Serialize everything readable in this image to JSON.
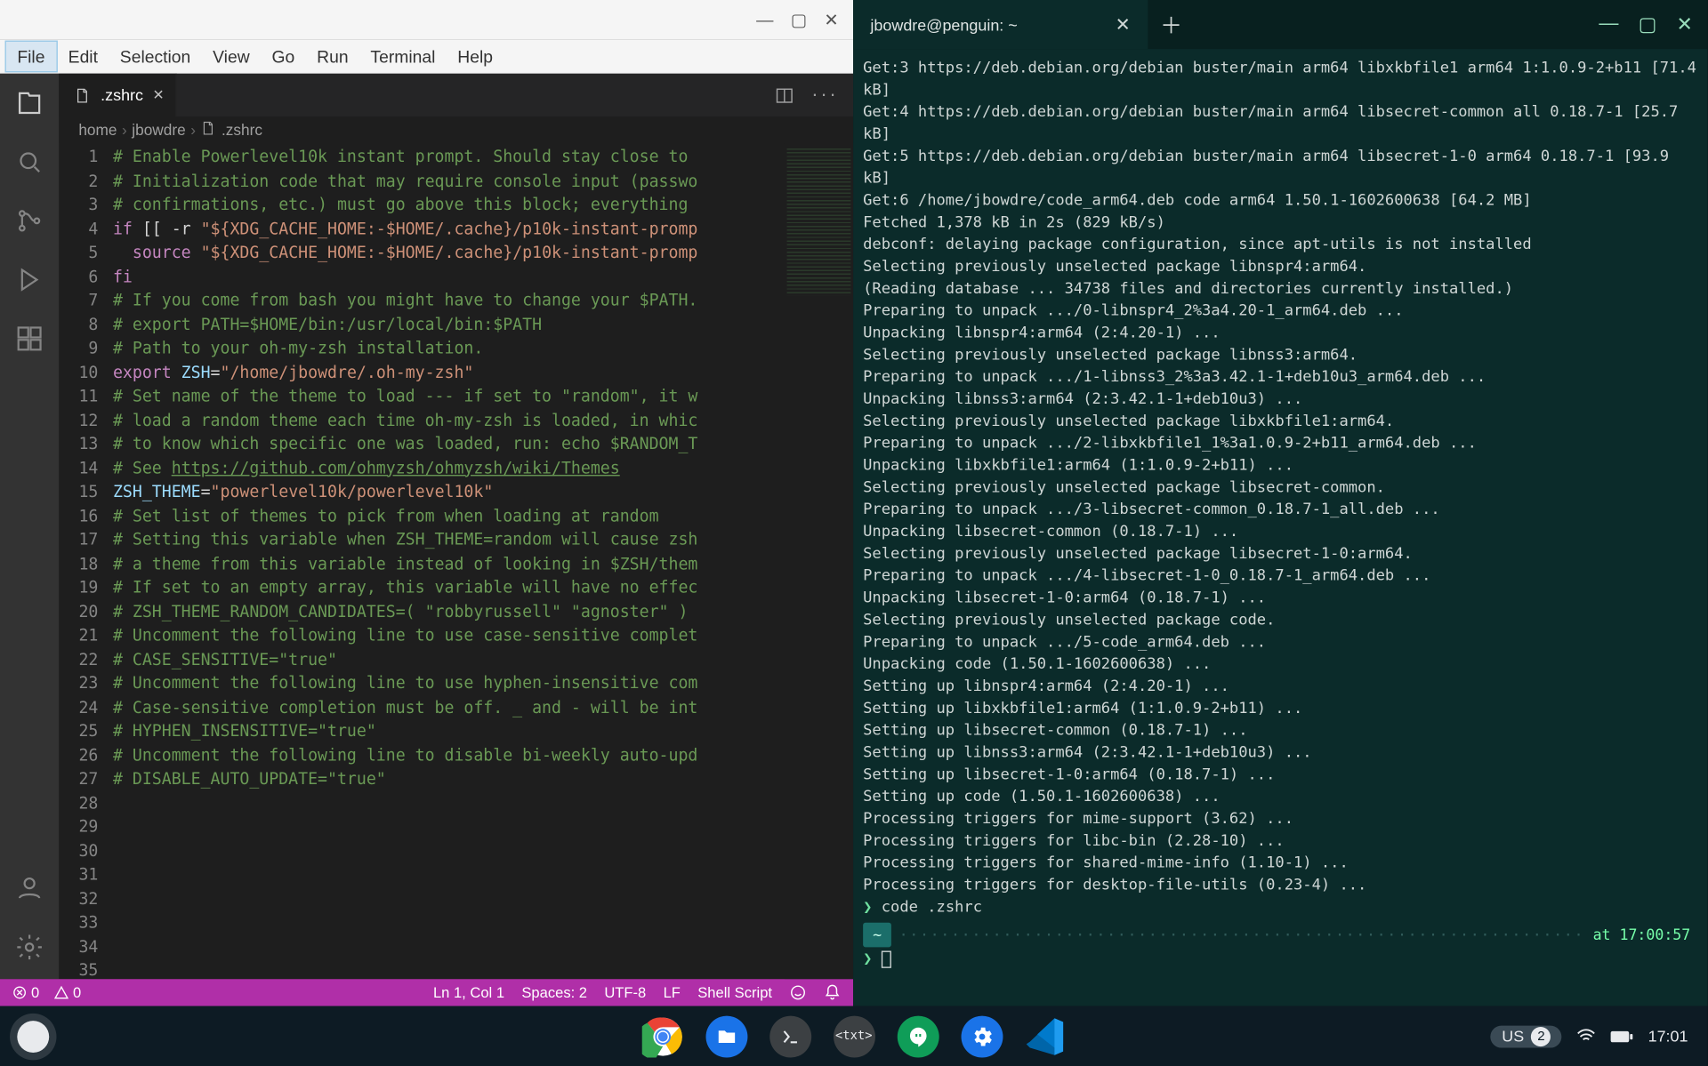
{
  "vscode": {
    "menubar": [
      "File",
      "Edit",
      "Selection",
      "View",
      "Go",
      "Run",
      "Terminal",
      "Help"
    ],
    "tab": {
      "filename": ".zshrc"
    },
    "breadcrumbs": [
      "home",
      "jbowdre",
      ".zshrc"
    ],
    "code_lines": [
      {
        "n": 1,
        "segs": [
          {
            "c": "tok-comment",
            "t": "# Enable Powerlevel10k instant prompt. Should stay close to "
          }
        ]
      },
      {
        "n": 2,
        "segs": [
          {
            "c": "tok-comment",
            "t": "# Initialization code that may require console input (passwo"
          }
        ]
      },
      {
        "n": 3,
        "segs": [
          {
            "c": "tok-comment",
            "t": "# confirmations, etc.) must go above this block; everything "
          }
        ]
      },
      {
        "n": 4,
        "segs": [
          {
            "c": "tok-keyword",
            "t": "if "
          },
          {
            "c": "",
            "t": "[[ -r "
          },
          {
            "c": "tok-string",
            "t": "\"${XDG_CACHE_HOME:-$HOME/.cache}/p10k-instant-promp"
          }
        ]
      },
      {
        "n": 5,
        "segs": [
          {
            "c": "",
            "t": "  "
          },
          {
            "c": "tok-keyword",
            "t": "source "
          },
          {
            "c": "tok-string",
            "t": "\"${XDG_CACHE_HOME:-$HOME/.cache}/p10k-instant-promp"
          }
        ]
      },
      {
        "n": 6,
        "segs": [
          {
            "c": "tok-keyword",
            "t": "fi"
          }
        ]
      },
      {
        "n": 7,
        "segs": [
          {
            "c": "",
            "t": ""
          }
        ]
      },
      {
        "n": 8,
        "segs": [
          {
            "c": "tok-comment",
            "t": "# If you come from bash you might have to change your $PATH."
          }
        ]
      },
      {
        "n": 9,
        "segs": [
          {
            "c": "tok-comment",
            "t": "# export PATH=$HOME/bin:/usr/local/bin:$PATH"
          }
        ]
      },
      {
        "n": 10,
        "segs": [
          {
            "c": "",
            "t": ""
          }
        ]
      },
      {
        "n": 11,
        "segs": [
          {
            "c": "tok-comment",
            "t": "# Path to your oh-my-zsh installation."
          }
        ]
      },
      {
        "n": 12,
        "segs": [
          {
            "c": "tok-keyword",
            "t": "export "
          },
          {
            "c": "tok-var",
            "t": "ZSH"
          },
          {
            "c": "",
            "t": "="
          },
          {
            "c": "tok-string",
            "t": "\"/home/jbowdre/.oh-my-zsh\""
          }
        ]
      },
      {
        "n": 13,
        "segs": [
          {
            "c": "",
            "t": ""
          }
        ]
      },
      {
        "n": 14,
        "segs": [
          {
            "c": "tok-comment",
            "t": "# Set name of the theme to load --- if set to \"random\", it w"
          }
        ]
      },
      {
        "n": 15,
        "segs": [
          {
            "c": "tok-comment",
            "t": "# load a random theme each time oh-my-zsh is loaded, in whic"
          }
        ]
      },
      {
        "n": 16,
        "segs": [
          {
            "c": "tok-comment",
            "t": "# to know which specific one was loaded, run: echo $RANDOM_T"
          }
        ]
      },
      {
        "n": 17,
        "segs": [
          {
            "c": "tok-comment",
            "t": "# See "
          },
          {
            "c": "tok-link",
            "t": "https://github.com/ohmyzsh/ohmyzsh/wiki/Themes"
          }
        ]
      },
      {
        "n": 18,
        "segs": [
          {
            "c": "tok-var",
            "t": "ZSH_THEME"
          },
          {
            "c": "",
            "t": "="
          },
          {
            "c": "tok-string",
            "t": "\"powerlevel10k/powerlevel10k\""
          }
        ]
      },
      {
        "n": 19,
        "segs": [
          {
            "c": "",
            "t": ""
          }
        ]
      },
      {
        "n": 20,
        "segs": [
          {
            "c": "tok-comment",
            "t": "# Set list of themes to pick from when loading at random"
          }
        ]
      },
      {
        "n": 21,
        "segs": [
          {
            "c": "tok-comment",
            "t": "# Setting this variable when ZSH_THEME=random will cause zsh"
          }
        ]
      },
      {
        "n": 22,
        "segs": [
          {
            "c": "tok-comment",
            "t": "# a theme from this variable instead of looking in $ZSH/them"
          }
        ]
      },
      {
        "n": 23,
        "segs": [
          {
            "c": "tok-comment",
            "t": "# If set to an empty array, this variable will have no effec"
          }
        ]
      },
      {
        "n": 24,
        "segs": [
          {
            "c": "tok-comment",
            "t": "# ZSH_THEME_RANDOM_CANDIDATES=( \"robbyrussell\" \"agnoster\" )"
          }
        ]
      },
      {
        "n": 25,
        "segs": [
          {
            "c": "",
            "t": ""
          }
        ]
      },
      {
        "n": 26,
        "segs": [
          {
            "c": "tok-comment",
            "t": "# Uncomment the following line to use case-sensitive complet"
          }
        ]
      },
      {
        "n": 27,
        "segs": [
          {
            "c": "tok-comment",
            "t": "# CASE_SENSITIVE=\"true\""
          }
        ]
      },
      {
        "n": 28,
        "segs": [
          {
            "c": "",
            "t": ""
          }
        ]
      },
      {
        "n": 29,
        "segs": [
          {
            "c": "tok-comment",
            "t": "# Uncomment the following line to use hyphen-insensitive com"
          }
        ]
      },
      {
        "n": 30,
        "segs": [
          {
            "c": "tok-comment",
            "t": "# Case-sensitive completion must be off. _ and - will be int"
          }
        ]
      },
      {
        "n": 31,
        "segs": [
          {
            "c": "tok-comment",
            "t": "# HYPHEN_INSENSITIVE=\"true\""
          }
        ]
      },
      {
        "n": 32,
        "segs": [
          {
            "c": "",
            "t": ""
          }
        ]
      },
      {
        "n": 33,
        "segs": [
          {
            "c": "tok-comment",
            "t": "# Uncomment the following line to disable bi-weekly auto-upd"
          }
        ]
      },
      {
        "n": 34,
        "segs": [
          {
            "c": "tok-comment",
            "t": "# DISABLE_AUTO_UPDATE=\"true\""
          }
        ]
      },
      {
        "n": 35,
        "segs": [
          {
            "c": "",
            "t": ""
          }
        ]
      }
    ],
    "statusbar": {
      "errors": "0",
      "warnings": "0",
      "cursor": "Ln 1, Col 1",
      "spaces": "Spaces: 2",
      "encoding": "UTF-8",
      "eol": "LF",
      "language": "Shell Script"
    }
  },
  "terminal": {
    "tab_title": "jbowdre@penguin: ~",
    "lines": [
      "Get:3 https://deb.debian.org/debian buster/main arm64 libxkbfile1 arm64 1:1.0.9-2+b11 [71.4 kB]",
      "Get:4 https://deb.debian.org/debian buster/main arm64 libsecret-common all 0.18.7-1 [25.7 kB]",
      "Get:5 https://deb.debian.org/debian buster/main arm64 libsecret-1-0 arm64 0.18.7-1 [93.9 kB]",
      "Get:6 /home/jbowdre/code_arm64.deb code arm64 1.50.1-1602600638 [64.2 MB]",
      "Fetched 1,378 kB in 2s (829 kB/s)",
      "debconf: delaying package configuration, since apt-utils is not installed",
      "Selecting previously unselected package libnspr4:arm64.",
      "(Reading database ... 34738 files and directories currently installed.)",
      "Preparing to unpack .../0-libnspr4_2%3a4.20-1_arm64.deb ...",
      "Unpacking libnspr4:arm64 (2:4.20-1) ...",
      "Selecting previously unselected package libnss3:arm64.",
      "Preparing to unpack .../1-libnss3_2%3a3.42.1-1+deb10u3_arm64.deb ...",
      "Unpacking libnss3:arm64 (2:3.42.1-1+deb10u3) ...",
      "Selecting previously unselected package libxkbfile1:arm64.",
      "Preparing to unpack .../2-libxkbfile1_1%3a1.0.9-2+b11_arm64.deb ...",
      "Unpacking libxkbfile1:arm64 (1:1.0.9-2+b11) ...",
      "Selecting previously unselected package libsecret-common.",
      "Preparing to unpack .../3-libsecret-common_0.18.7-1_all.deb ...",
      "Unpacking libsecret-common (0.18.7-1) ...",
      "Selecting previously unselected package libsecret-1-0:arm64.",
      "Preparing to unpack .../4-libsecret-1-0_0.18.7-1_arm64.deb ...",
      "Unpacking libsecret-1-0:arm64 (0.18.7-1) ...",
      "Selecting previously unselected package code.",
      "Preparing to unpack .../5-code_arm64.deb ...",
      "Unpacking code (1.50.1-1602600638) ...",
      "Setting up libnspr4:arm64 (2:4.20-1) ...",
      "Setting up libxkbfile1:arm64 (1:1.0.9-2+b11) ...",
      "Setting up libsecret-common (0.18.7-1) ...",
      "Setting up libnss3:arm64 (2:3.42.1-1+deb10u3) ...",
      "Setting up libsecret-1-0:arm64 (0.18.7-1) ...",
      "Setting up code (1.50.1-1602600638) ...",
      "Processing triggers for mime-support (3.62) ...",
      "Processing triggers for libc-bin (2.28-10) ...",
      "Processing triggers for shared-mime-info (1.10-1) ...",
      "Processing triggers for desktop-file-utils (0.23-4) ..."
    ],
    "last_command": "code .zshrc",
    "prompt_cwd": "~",
    "prompt_time": "at 17:00:57",
    "prompt_symbol": "❯"
  },
  "taskbar": {
    "ime": "US",
    "notif_count": "2",
    "clock": "17:01"
  }
}
